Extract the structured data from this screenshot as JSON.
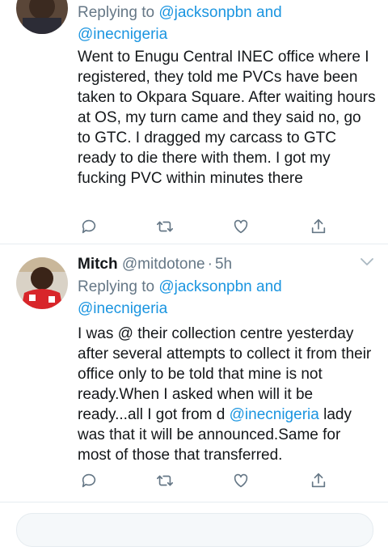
{
  "tweet1": {
    "reply_prefix": "Replying to",
    "mention1": "@jacksonpbn",
    "and_word": "and",
    "mention2": "@inecnigeria",
    "text": "Went to Enugu Central INEC office where I registered, they told me PVCs have been taken to Okpara Square. After waiting hours at OS, my turn came and they said no, go to GTC. I dragged my carcass to GTC ready to die there with them. I got my fucking PVC within minutes there"
  },
  "tweet2": {
    "name": "Mitch",
    "handle": "@mitdotone",
    "separator": "·",
    "time": "5h",
    "reply_prefix": "Replying to",
    "mention1": "@jacksonpbn",
    "and_word": "and",
    "mention2": "@inecnigeria",
    "text_before": "I was @ their collection centre yesterday after several attempts to collect it from their office only to be told that mine is not ready.When I asked when will it be ready...all I got from d ",
    "text_mention": "@inecnigeria",
    "text_after": " lady was that it will be announced.Same for most of those that transferred."
  },
  "icons": [
    "reply-icon",
    "retweet-icon",
    "like-icon",
    "share-icon",
    "chevron-down-icon"
  ],
  "colors": {
    "link": "#1b95e0",
    "secondary": "#657786",
    "icon": "#657786",
    "divider": "#e6ecf0"
  }
}
